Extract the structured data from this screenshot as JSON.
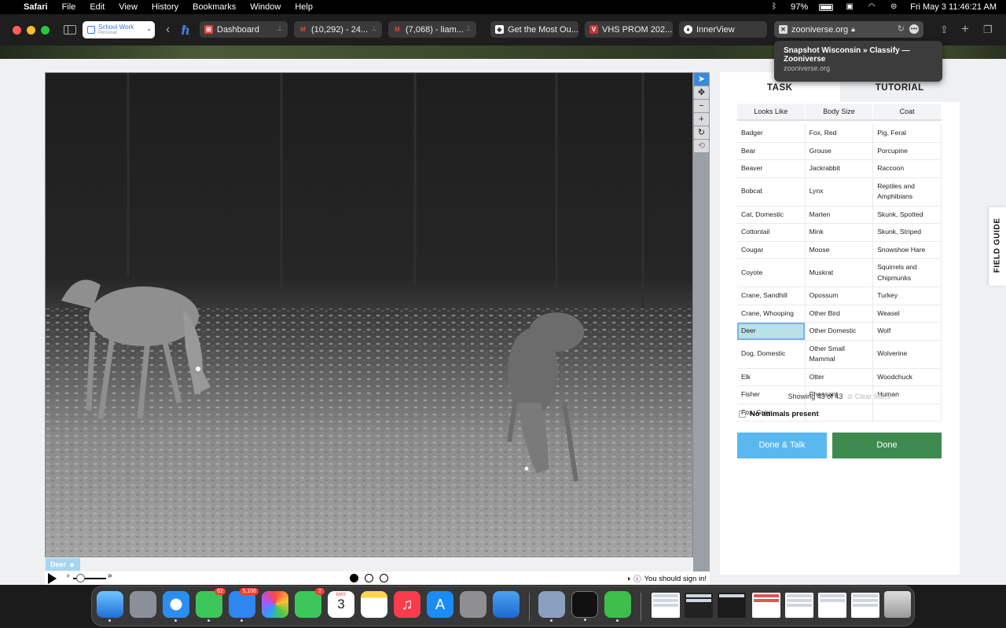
{
  "menubar": {
    "app": "Safari",
    "items": [
      "File",
      "Edit",
      "View",
      "History",
      "Bookmarks",
      "Window",
      "Help"
    ],
    "battery": "97%",
    "datetime": "Fri May 3  11:46:21 AM"
  },
  "toolbar": {
    "profile_name": "School Work",
    "profile_sub": "Personal",
    "tabs": [
      {
        "label": "Dashboard",
        "fav_color": "#e0473f"
      },
      {
        "label": "(10,292) - 24...",
        "fav_color": "#4285f4"
      },
      {
        "label": "(7,068) - liam...",
        "fav_color": "#4285f4"
      },
      {
        "label": "Get the Most Ou...",
        "fav_color": "#ffffff"
      },
      {
        "label": "VHS PROM 202...",
        "fav_color": "#cc3333"
      },
      {
        "label": "InnerView",
        "fav_color": "#ffffff"
      }
    ],
    "address": "zooniverse.org"
  },
  "tooltip": {
    "title": "Snapshot Wisconsin » Classify — Zooniverse",
    "url": "zooniverse.org"
  },
  "viewer": {
    "mark_label": "Deer",
    "signin": "You should sign in!",
    "frames": 3,
    "current_frame": 1
  },
  "panel": {
    "tab_task": "TASK",
    "tab_tutorial": "TUTORIAL",
    "filters": [
      "Looks Like",
      "Body Size",
      "Coat"
    ],
    "rows": [
      [
        "Badger",
        "Fox, Red",
        "Pig, Feral"
      ],
      [
        "Bear",
        "Grouse",
        "Porcupine"
      ],
      [
        "Beaver",
        "Jackrabbit",
        "Raccoon"
      ],
      [
        "Bobcat",
        "Lynx",
        "Reptiles and Amphibians"
      ],
      [
        "Cat, Domestic",
        "Marten",
        "Skunk, Spotted"
      ],
      [
        "Cottontail",
        "Mink",
        "Skunk, Striped"
      ],
      [
        "Cougar",
        "Moose",
        "Snowshoe Hare"
      ],
      [
        "Coyote",
        "Muskrat",
        "Squirrels and Chipmunks"
      ],
      [
        "Crane, Sandhill",
        "Opossum",
        "Turkey"
      ],
      [
        "Crane, Whooping",
        "Other Bird",
        "Weasel"
      ],
      [
        "Deer",
        "Other Domestic",
        "Wolf"
      ],
      [
        "Dog, Domestic",
        "Other Small Mammal",
        "Wolverine"
      ],
      [
        "Elk",
        "Otter",
        "Woodchuck"
      ],
      [
        "Fisher",
        "Pheasant",
        "Human"
      ],
      [
        "Fox, Gray",
        "",
        ""
      ]
    ],
    "selected": "Deer",
    "showing": "Showing 43 of 43",
    "clear_filters": "Clear filters",
    "no_animals": "No animals present",
    "done_talk": "Done & Talk",
    "done": "Done",
    "field_guide": "FIELD GUIDE"
  },
  "dock": {
    "messages_badge": "62",
    "mail_badge": "5,106",
    "facetime_badge": "2",
    "calendar_month": "MAY",
    "calendar_day": "3"
  }
}
